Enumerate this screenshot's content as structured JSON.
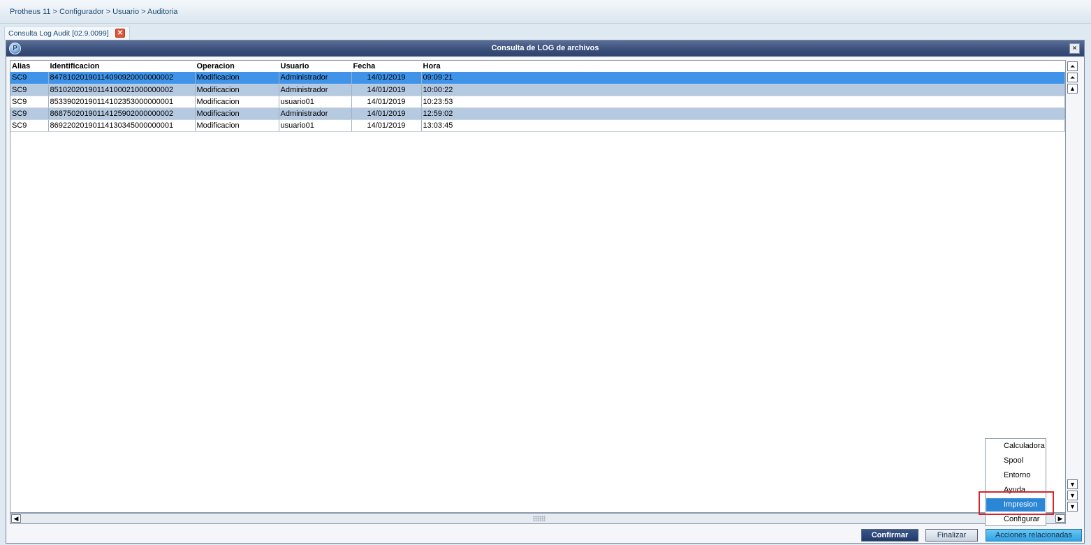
{
  "breadcrumb": "Protheus 11 > Configurador > Usuario > Auditoria",
  "tab": {
    "label": "Consulta Log Audit [02.9.0099]",
    "close": "✕"
  },
  "window": {
    "title": "Consulta de LOG de archivos",
    "close": "×"
  },
  "table": {
    "columns": [
      "Alias",
      "Identificacion",
      "Operacion",
      "Usuario",
      "Fecha",
      "Hora"
    ],
    "rows": [
      [
        "SC9",
        "84781020190114090920000000002",
        "Modificacion",
        "Administrador",
        "14/01/2019",
        "09:09:21"
      ],
      [
        "SC9",
        "85102020190114100021000000002",
        "Modificacion",
        "Administrador",
        "14/01/2019",
        "10:00:22"
      ],
      [
        "SC9",
        "85339020190114102353000000001",
        "Modificacion",
        "usuario01",
        "14/01/2019",
        "10:23:53"
      ],
      [
        "SC9",
        "86875020190114125902000000002",
        "Modificacion",
        "Administrador",
        "14/01/2019",
        "12:59:02"
      ],
      [
        "SC9",
        "86922020190114130345000000001",
        "Modificacion",
        "usuario01",
        "14/01/2019",
        "13:03:45"
      ]
    ],
    "selected_row": 0
  },
  "menu": {
    "items": [
      "Calculadora",
      "Spool",
      "Entorno",
      "Ayuda",
      "Impresion",
      "Configurar"
    ],
    "active_item": "Impresion"
  },
  "buttons": {
    "confirmar": "Confirmar",
    "finalizar": "Finalizar",
    "acciones": "Acciones relacionadas"
  },
  "icons": {
    "scroll_top": "⏶",
    "scroll_up": "▲",
    "scroll_down": "▼",
    "scroll_left": "◀",
    "scroll_right": "▶"
  },
  "colors": {
    "selected_row": "#3f93e8",
    "alt_row": "#b5c9e1",
    "titlebar": "#3a4f7a",
    "menu_highlight_border": "#d6242b"
  }
}
